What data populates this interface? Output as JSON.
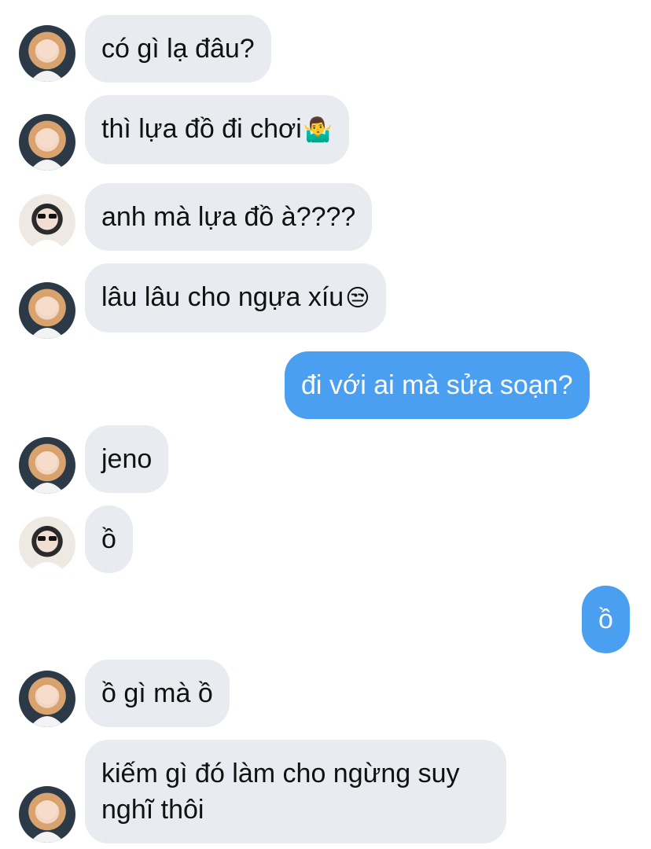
{
  "colors": {
    "incoming_bg": "#e8ebf0",
    "outgoing_bg": "#4a9ff0",
    "incoming_text": "#111111",
    "outgoing_text": "#ffffff"
  },
  "messages": [
    {
      "sender": "friend_a",
      "text": "có gì lạ đâu?",
      "emoji": ""
    },
    {
      "sender": "friend_a",
      "text": "thì lựa đồ đi chơi",
      "emoji": "🤷‍♂️"
    },
    {
      "sender": "friend_b",
      "text": "anh mà lựa đồ à????",
      "emoji": ""
    },
    {
      "sender": "friend_a",
      "text": "lâu lâu cho ngựa xíu",
      "emoji": "😒"
    },
    {
      "sender": "me",
      "text": "đi với ai mà sửa soạn?",
      "emoji": ""
    },
    {
      "sender": "friend_a",
      "text": "jeno",
      "emoji": ""
    },
    {
      "sender": "friend_b",
      "text": "ồ",
      "emoji": ""
    },
    {
      "sender": "me",
      "text": "ồ",
      "emoji": ""
    },
    {
      "sender": "friend_a",
      "text": "ồ gì mà ồ",
      "emoji": ""
    },
    {
      "sender": "friend_a",
      "text": "kiếm gì đó làm cho ngừng suy nghĩ thôi",
      "emoji": ""
    }
  ],
  "avatars": {
    "friend_a": "avatar-photo-orange-hair",
    "friend_b": "avatar-photo-sunglasses"
  }
}
